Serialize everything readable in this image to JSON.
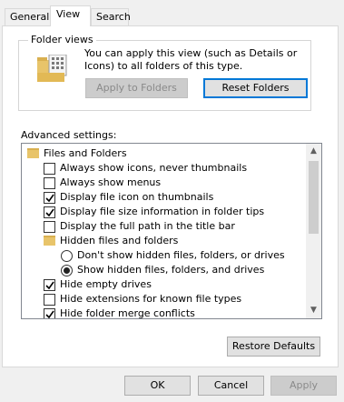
{
  "tabs": [
    {
      "label": "General"
    },
    {
      "label": "View"
    },
    {
      "label": "Search"
    }
  ],
  "folder_views": {
    "title": "Folder views",
    "description": "You can apply this view (such as Details or Icons) to all folders of this type.",
    "apply_label": "Apply to Folders",
    "reset_label": "Reset Folders"
  },
  "advanced": {
    "title": "Advanced settings:",
    "items": [
      {
        "label": "Files and Folders",
        "kind": "folder"
      },
      {
        "label": "Always show icons, never thumbnails",
        "kind": "checkbox",
        "checked": false
      },
      {
        "label": "Always show menus",
        "kind": "checkbox",
        "checked": false
      },
      {
        "label": "Display file icon on thumbnails",
        "kind": "checkbox",
        "checked": true
      },
      {
        "label": "Display file size information in folder tips",
        "kind": "checkbox",
        "checked": true
      },
      {
        "label": "Display the full path in the title bar",
        "kind": "checkbox",
        "checked": false
      },
      {
        "label": "Hidden files and folders",
        "kind": "folder"
      },
      {
        "label": "Don't show hidden files, folders, or drives",
        "kind": "radio",
        "selected": false
      },
      {
        "label": "Show hidden files, folders, and drives",
        "kind": "radio",
        "selected": true
      },
      {
        "label": "Hide empty drives",
        "kind": "checkbox",
        "checked": true
      },
      {
        "label": "Hide extensions for known file types",
        "kind": "checkbox",
        "checked": false
      },
      {
        "label": "Hide folder merge conflicts",
        "kind": "checkbox",
        "checked": true
      }
    ]
  },
  "restore_label": "Restore Defaults",
  "footer": {
    "ok_label": "OK",
    "cancel_label": "Cancel",
    "apply_label": "Apply"
  },
  "colors": {
    "focus_border": "#0078d7",
    "folder": "#e8c46a"
  }
}
